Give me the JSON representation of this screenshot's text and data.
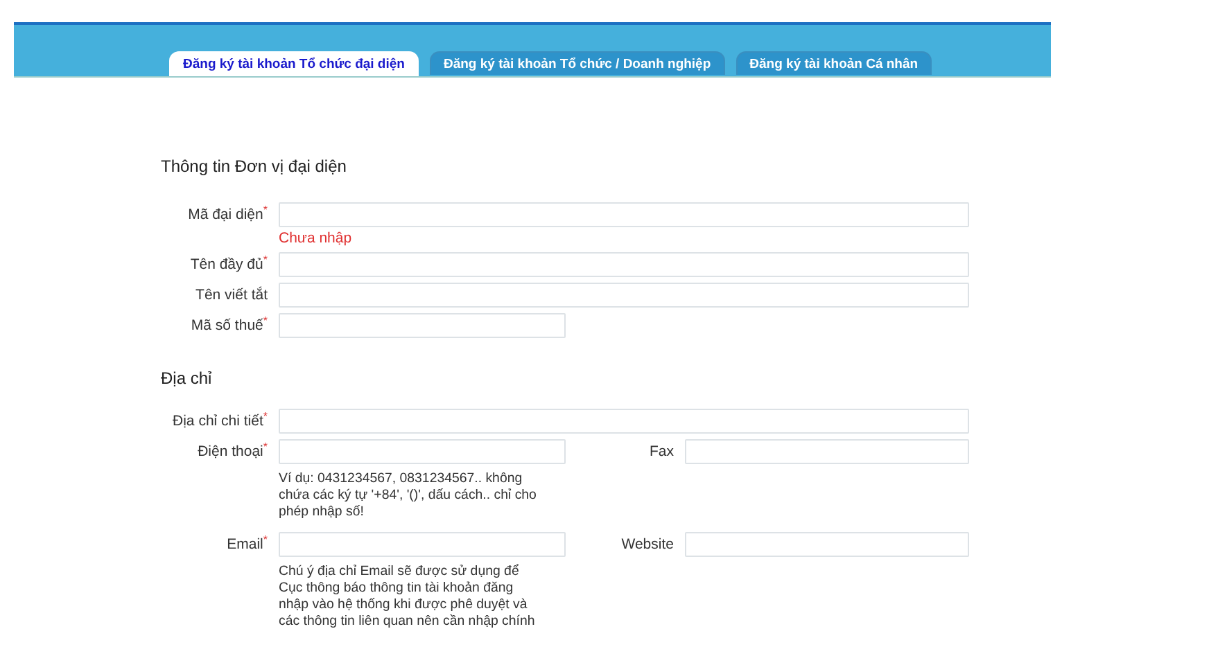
{
  "tabs": [
    {
      "label": "Đăng ký tài khoản Tổ chức đại diện",
      "selected": true
    },
    {
      "label": "Đăng ký tài khoản Tổ chức / Doanh nghiệp",
      "selected": false
    },
    {
      "label": "Đăng ký tài khoản Cá nhân",
      "selected": false
    }
  ],
  "sections": [
    {
      "title": "Thông tin Đơn vị đại diện",
      "rows": [
        {
          "fields": [
            {
              "label": "Mã đại diện",
              "required_mark": "*",
              "kind": "wide",
              "error": "Chưa nhập"
            }
          ]
        },
        {
          "fields": [
            {
              "label": "Tên đầy đủ",
              "required_mark": "*",
              "kind": "wide"
            }
          ]
        },
        {
          "fields": [
            {
              "label": "Tên viết tắt",
              "kind": "wide"
            }
          ]
        },
        {
          "fields": [
            {
              "label": "Mã số thuế",
              "required_mark": "*",
              "kind": "short"
            }
          ]
        }
      ]
    },
    {
      "title": "Địa chỉ",
      "rows": [
        {
          "fields": [
            {
              "label": "Địa chỉ chi tiết",
              "required_mark": "*",
              "kind": "wide"
            }
          ]
        },
        {
          "fields": [
            {
              "label": "Điện thoại",
              "required_mark": "*",
              "kind": "short",
              "hint": "Ví dụ: 0431234567, 0831234567.. không chứa các ký tự '+84', '()', dấu cách.. chỉ cho phép nhập số!"
            },
            {
              "label": "Fax"
            }
          ]
        },
        {
          "fields": [
            {
              "label": "Email",
              "required_mark": "*",
              "kind": "short",
              "hint": "Chú ý địa chỉ Email sẽ được sử dụng để Cục thông báo thông tin tài khoản đăng nhập vào hệ thống khi được phê duyệt và các thông tin liên quan nên cần nhập chính"
            },
            {
              "label": "Website"
            }
          ]
        }
      ]
    }
  ]
}
